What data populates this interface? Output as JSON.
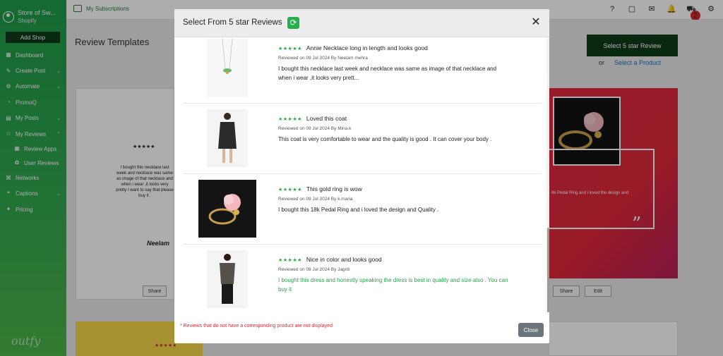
{
  "sidebar": {
    "store_name": "Store of Sw...",
    "store_platform": "Shopify",
    "add_shop": "Add Shop",
    "items": [
      {
        "label": "Dashboard",
        "icon": "dashboard-icon"
      },
      {
        "label": "Create Post",
        "icon": "pencil-icon"
      },
      {
        "label": "Automate",
        "icon": "automate-icon"
      },
      {
        "label": "PromoQ",
        "icon": "promo-icon"
      },
      {
        "label": "My Posts",
        "icon": "posts-icon"
      },
      {
        "label": "My Reviews",
        "icon": "star-icon"
      },
      {
        "label": "Review Apps",
        "icon": "apps-icon"
      },
      {
        "label": "User Reviews",
        "icon": "reviews-icon"
      },
      {
        "label": "Networks",
        "icon": "network-icon"
      },
      {
        "label": "Captions",
        "icon": "captions-icon"
      },
      {
        "label": "Pricing",
        "icon": "pricing-icon"
      }
    ],
    "logo": "outfy"
  },
  "topbar": {
    "subscriptions": "My Subscriptions",
    "notification_count": "2"
  },
  "main": {
    "title": "Review Templates",
    "select_review_btn": "Select 5 star Review",
    "or": "or",
    "select_product": "Select a Product",
    "card_text": "I bought this necklace last week and necklace was same as image of that necklace and when i wear ,it looks very pretty I want to say that please buy it .",
    "card_name": "Neelam",
    "red_card_text": "8k Pedal Ring and i loved the design and",
    "share": "Share",
    "edit": "Edit"
  },
  "modal": {
    "title": "Select From 5 star Reviews",
    "reviews": [
      {
        "stars": "★★★★★",
        "title": "Annie Necklace long in length and looks good",
        "meta": "Reviewed on 09 Jul 2024 By Neelam mehra",
        "body": "I bought this necklace last week and necklace was same as image of that necklace and when i wear ,it looks very prett..."
      },
      {
        "stars": "★★★★★",
        "title": "Loved this coat",
        "meta": "Reviewed on 09 Jul 2024 By Mina.k",
        "body": "This coat is very comfortable to wear and the quality is good . It can cover your body ."
      },
      {
        "stars": "★★★★★",
        "title": "This gold ring is wow",
        "meta": "Reviewed on 09 Jul 2024 By k.maria",
        "body": "I bought this 18k Pedal Ring and i loved the design and Quality ."
      },
      {
        "stars": "★★★★★",
        "title": "Nice in color and looks good",
        "meta": "Reviewed on 08 Jul 2024 By Jagriti",
        "body": "I bought this dress and honestly speaking the dress is best in quality and size also . You can buy it"
      }
    ],
    "footer_note": "* Reviews that do not have a corresponding product are not displayed",
    "close": "Close"
  },
  "colors": {
    "brand_green": "#27ae4f",
    "dark_green": "#0d3b1a",
    "accent_red": "#e02a44"
  }
}
